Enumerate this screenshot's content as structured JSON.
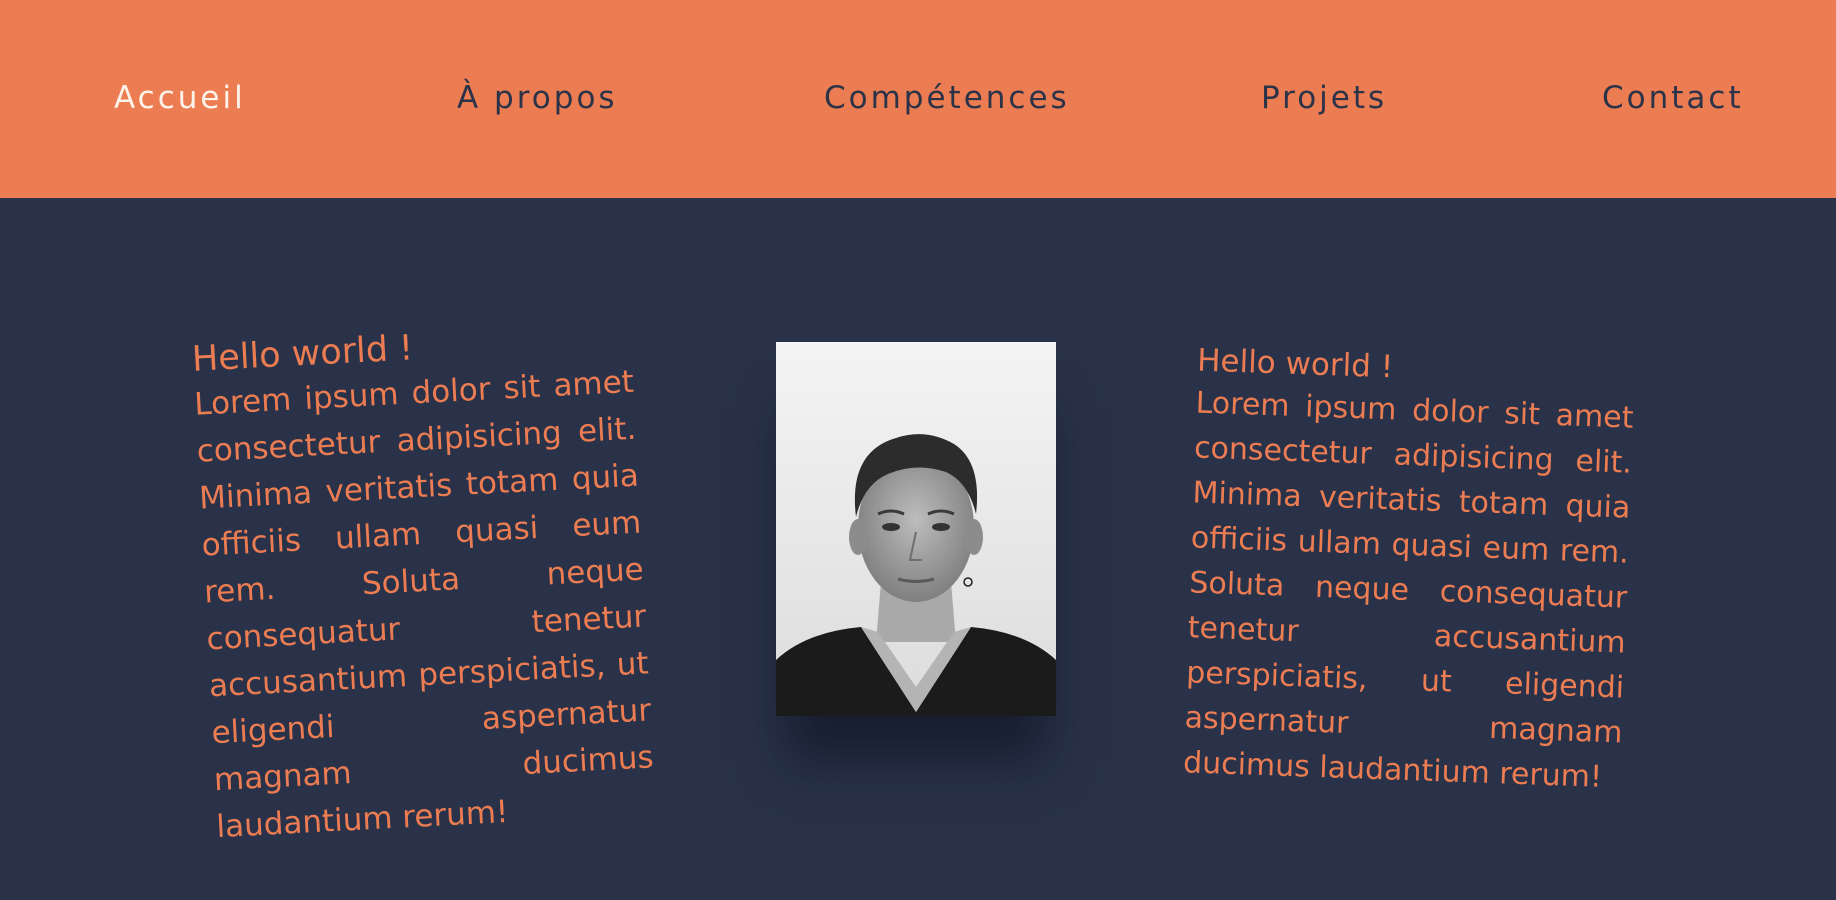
{
  "nav": {
    "items": [
      {
        "label": "Accueil",
        "active": true
      },
      {
        "label": "À propos",
        "active": false
      },
      {
        "label": "Compétences",
        "active": false
      },
      {
        "label": "Projets",
        "active": false
      },
      {
        "label": "Contact",
        "active": false
      }
    ]
  },
  "content": {
    "left": {
      "greeting": "Hello world !",
      "paragraph": "Lorem ipsum dolor sit amet consectetur adipisicing elit. Minima veritatis totam quia officiis ullam quasi eum rem. Soluta neque consequatur tenetur accusantium perspiciatis, ut eligendi aspernatur magnam ducimus laudantium rerum!"
    },
    "right": {
      "greeting": "Hello world !",
      "paragraph": "Lorem ipsum dolor sit amet consectetur adipisicing elit. Minima veritatis totam quia officiis ullam quasi eum rem. Soluta neque consequatur tenetur accusantium perspiciatis, ut eligendi aspernatur magnam ducimus laudantium rerum!"
    }
  },
  "colors": {
    "accent": "#ec7c52",
    "background": "#293249",
    "nav_text": "#2b3348",
    "nav_active": "#fdf3ea"
  }
}
